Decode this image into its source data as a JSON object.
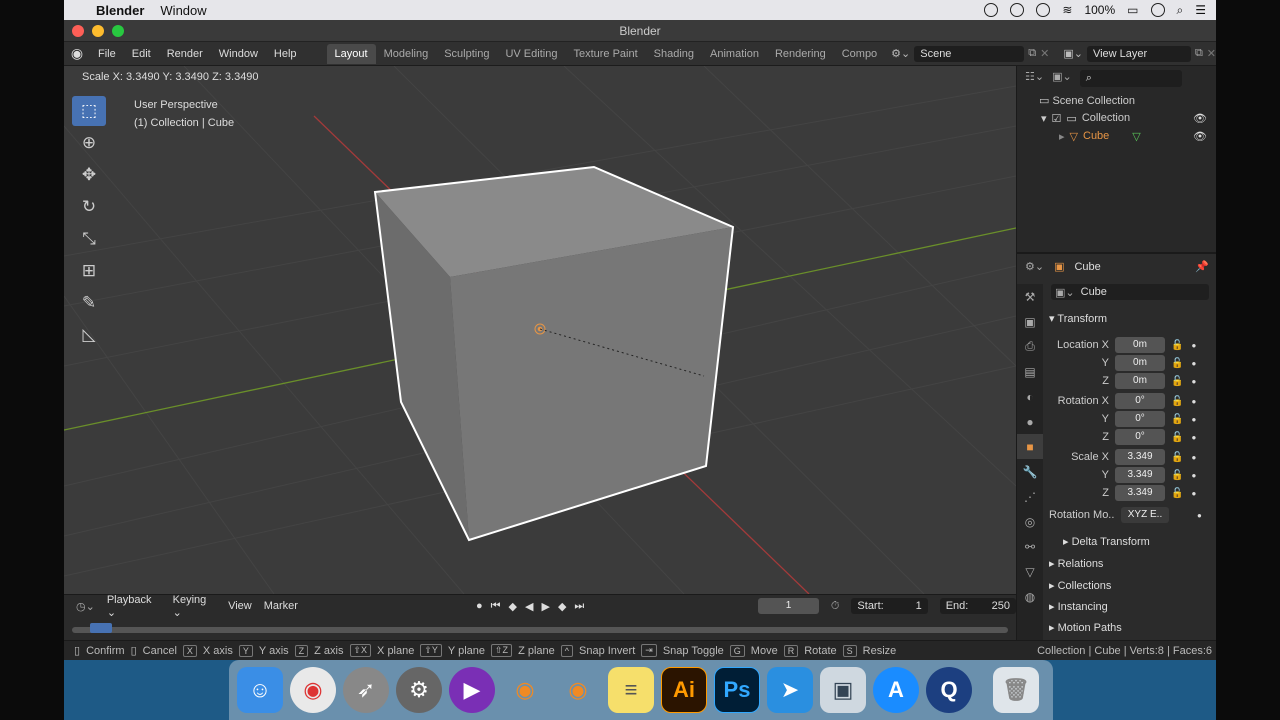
{
  "mac_menubar": {
    "app_name": "Blender",
    "menu_window": "Window",
    "battery": "100%"
  },
  "window": {
    "title": "Blender"
  },
  "top_menu": {
    "items": [
      "File",
      "Edit",
      "Render",
      "Window",
      "Help"
    ]
  },
  "workspace_tabs": [
    "Layout",
    "Modeling",
    "Sculpting",
    "UV Editing",
    "Texture Paint",
    "Shading",
    "Animation",
    "Rendering",
    "Compo"
  ],
  "active_workspace": "Layout",
  "scene_field": "Scene",
  "view_layer_field": "View Layer",
  "viewport": {
    "header_text": "Scale X: 3.3490   Y: 3.3490   Z: 3.3490",
    "info_line1": "User Perspective",
    "info_line2": "(1) Collection | Cube"
  },
  "outliner": {
    "scene_collection": "Scene Collection",
    "collection": "Collection",
    "object": "Cube"
  },
  "properties": {
    "object_name_header": "Cube",
    "object_name_field": "Cube",
    "transform_label": "Transform",
    "location": {
      "label_x": "Location X",
      "label_y": "Y",
      "label_z": "Z",
      "x": "0m",
      "y": "0m",
      "z": "0m"
    },
    "rotation": {
      "label_x": "Rotation X",
      "label_y": "Y",
      "label_z": "Z",
      "x": "0°",
      "y": "0°",
      "z": "0°"
    },
    "scale": {
      "label_x": "Scale X",
      "label_y": "Y",
      "label_z": "Z",
      "x": "3.349",
      "y": "3.349",
      "z": "3.349"
    },
    "rotation_mode_label": "Rotation Mo..",
    "rotation_mode_value": "XYZ E..",
    "sections": [
      "Delta Transform",
      "Relations",
      "Collections",
      "Instancing",
      "Motion Paths"
    ]
  },
  "timeline": {
    "playback": "Playback",
    "keying": "Keying",
    "view": "View",
    "marker": "Marker",
    "current_frame": "1",
    "start_label": "Start:",
    "start_value": "1",
    "end_label": "End:",
    "end_value": "250"
  },
  "statusbar": {
    "items": [
      {
        "key": "",
        "label": "Confirm"
      },
      {
        "key": "",
        "label": "Cancel"
      },
      {
        "key": "X",
        "label": "X axis"
      },
      {
        "key": "Y",
        "label": "Y axis"
      },
      {
        "key": "Z",
        "label": "Z axis"
      },
      {
        "key": "⇧X",
        "label": "X plane"
      },
      {
        "key": "⇧Y",
        "label": "Y plane"
      },
      {
        "key": "⇧Z",
        "label": "Z plane"
      },
      {
        "key": "^",
        "label": "Snap Invert"
      },
      {
        "key": "",
        "label": "Snap Toggle"
      },
      {
        "key": "G",
        "label": "Move"
      },
      {
        "key": "R",
        "label": "Rotate"
      },
      {
        "key": "S",
        "label": "Resize"
      }
    ],
    "right_text": "Collection | Cube | Verts:8 | Faces:6"
  },
  "dock_apps": [
    "Finder",
    "Chrome",
    "Launchpad",
    "System Preferences",
    "Screen Recorder",
    "Blender",
    "Blender",
    "Notes",
    "Illustrator",
    "Photoshop",
    "Cursor App",
    "Preview",
    "App Store",
    "QuickTime",
    "Trash"
  ],
  "colors": {
    "selection_outline": "#ffffff",
    "active_accent": "#4772b3",
    "object_orange": "#e79545",
    "x_axis": "#a33a3a",
    "y_axis": "#6a8f2a"
  }
}
